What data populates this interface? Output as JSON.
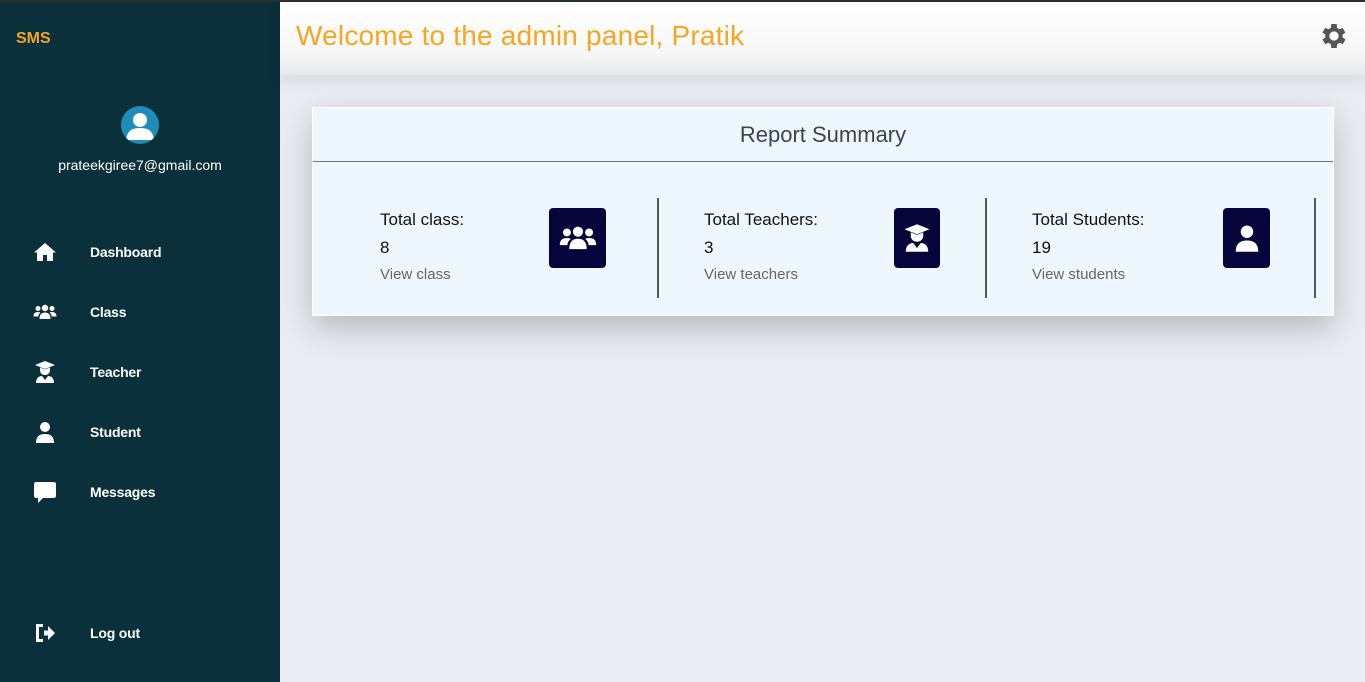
{
  "app": {
    "brand": "SMS"
  },
  "user": {
    "email": "prateekgiree7@gmail.com"
  },
  "sidebar": {
    "items": [
      {
        "label": "Dashboard",
        "icon": "home-icon"
      },
      {
        "label": "Class",
        "icon": "users-icon"
      },
      {
        "label": "Teacher",
        "icon": "graduate-icon"
      },
      {
        "label": "Student",
        "icon": "user-icon"
      },
      {
        "label": "Messages",
        "icon": "message-icon"
      }
    ],
    "logout_label": "Log out"
  },
  "header": {
    "welcome": "Welcome to the admin panel, Pratik"
  },
  "report": {
    "title": "Report Summary",
    "stats": [
      {
        "label": "Total class:",
        "value": "8",
        "link": "View class",
        "icon": "users-icon"
      },
      {
        "label": "Total Teachers:",
        "value": "3",
        "link": "View teachers",
        "icon": "graduate-icon"
      },
      {
        "label": "Total Students:",
        "value": "19",
        "link": "View students",
        "icon": "user-icon"
      }
    ]
  },
  "colors": {
    "sidebar_bg": "#0a313b",
    "accent": "#f5a623",
    "card_bg": "#eef6fe",
    "stat_box": "#05053b"
  }
}
